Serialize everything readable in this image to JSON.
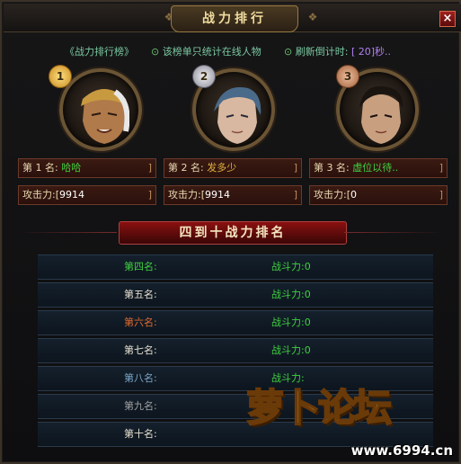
{
  "window": {
    "title": "战力排行",
    "close_label": "×"
  },
  "info": {
    "board_label": "《战力排行榜》",
    "note": "该榜单只统计在线人物",
    "refresh_label": "刷新倒计时:",
    "timer_value": "[ 20]秒.."
  },
  "top3": [
    {
      "medal": "1",
      "rank_label": "第 1 名:",
      "name": "哈哈",
      "attack_label": "攻击力:",
      "attack": "9914",
      "bracket": "]"
    },
    {
      "medal": "2",
      "rank_label": "第 2 名:",
      "name": "发多少",
      "attack_label": "攻击力:",
      "attack": "9914",
      "bracket": "]"
    },
    {
      "medal": "3",
      "rank_label": "第 3 名:",
      "name": "虚位以待..",
      "attack_label": "攻击力:",
      "attack": "0",
      "bracket": "]"
    }
  ],
  "section": {
    "title": "四到十战力排名"
  },
  "ranks": [
    {
      "place": "第四名:",
      "power_label": "战斗力:",
      "power": "0",
      "color": "#40d040"
    },
    {
      "place": "第五名:",
      "power_label": "战斗力:",
      "power": "0",
      "color": "#e8e0d0"
    },
    {
      "place": "第六名:",
      "power_label": "战斗力:",
      "power": "0",
      "color": "#e06a30"
    },
    {
      "place": "第七名:",
      "power_label": "战斗力:",
      "power": "0",
      "color": "#e8e0d0"
    },
    {
      "place": "第八名:",
      "power_label": "战斗力:",
      "power": "",
      "color": "#7aa6c8"
    },
    {
      "place": "第九名:",
      "power_label": "",
      "power": "",
      "color": "#a0a0a0"
    },
    {
      "place": "第十名:",
      "power_label": "",
      "power": "",
      "color": "#e8e0d0"
    }
  ],
  "watermark": {
    "text": "萝卜论坛",
    "url": "www.6994.cn"
  },
  "colors": {
    "power_label": "#40d040",
    "name_green": "#40d040",
    "name_gold": "#e0b040",
    "timer": "#b080f0"
  }
}
